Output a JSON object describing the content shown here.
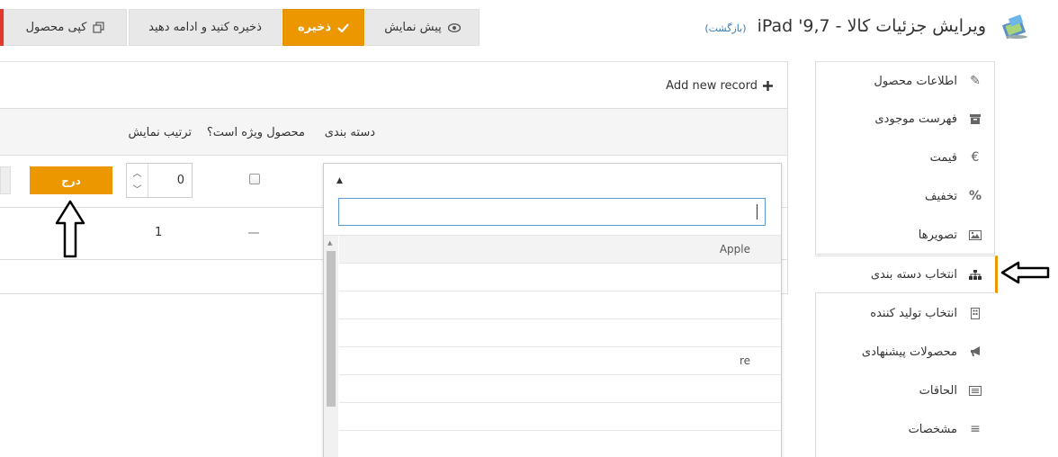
{
  "header": {
    "title": "ویرایش جزئیات کالا - iPad '9,7",
    "back_link": "(بازگشت)"
  },
  "toolbar": {
    "preview": "پیش نمایش",
    "save": "ذخیره",
    "save_continue": "ذخیره کنید و ادامه دهید",
    "copy": "کپی محصول"
  },
  "menu": {
    "items": [
      {
        "label": "اطلاعات محصول",
        "icon": "pencil-icon"
      },
      {
        "label": "فهرست موجودی",
        "icon": "archive-icon"
      },
      {
        "label": "قیمت",
        "icon": "euro-icon"
      },
      {
        "label": "تخفیف",
        "icon": "percent-icon"
      },
      {
        "label": "تصویرها",
        "icon": "image-icon"
      },
      {
        "label": "انتخاب دسته بندی",
        "icon": "sitemap-icon"
      },
      {
        "label": "انتخاب تولید کننده",
        "icon": "building-icon"
      },
      {
        "label": "محصولات پیشنهادی",
        "icon": "bullhorn-icon"
      },
      {
        "label": "الحاقات",
        "icon": "list-alt-icon"
      },
      {
        "label": "مشخصات",
        "icon": "bars-icon"
      }
    ]
  },
  "grid": {
    "add_record": "Add new record",
    "columns": {
      "category": "دسته بندی",
      "featured": "محصول ویژه است؟",
      "display_order": "ترتیب نمایش"
    },
    "insert_button": "درج",
    "edit_display_order": "0",
    "row1_display_order": "1"
  },
  "dropdown": {
    "options": [
      "Apple",
      "",
      "",
      "",
      "re",
      "",
      "",
      ""
    ]
  },
  "colors": {
    "accent": "#ec9600",
    "link": "#337ab7",
    "danger": "#e2372a"
  }
}
